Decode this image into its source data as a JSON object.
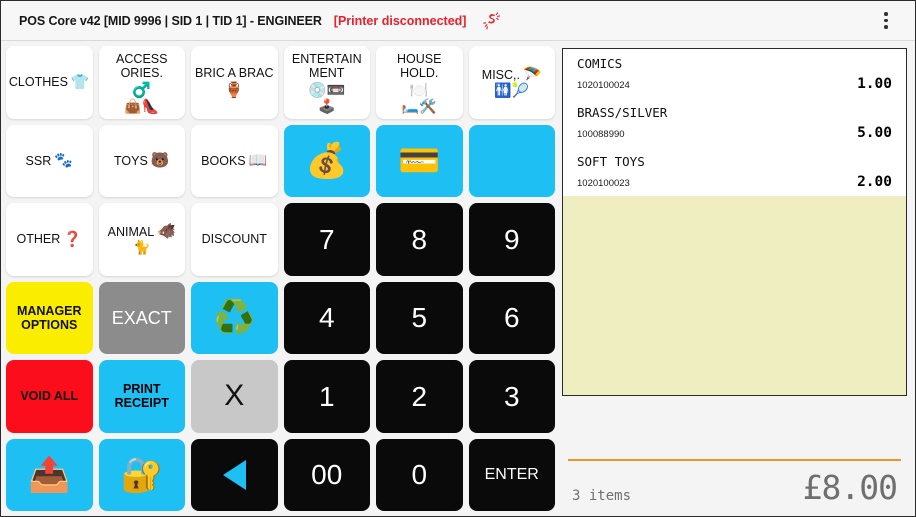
{
  "titlebar": {
    "title": "POS Core v42 [MID 9996 | SID 1 | TID 1] - ENGINEER",
    "status": "[Printer disconnected]",
    "disconnect_icon": "printer-disconnected-icon",
    "menu_icon": "overflow-menu-icon"
  },
  "keypad": {
    "buttons": [
      {
        "id": "clothes",
        "label": "CLOTHES",
        "emoji": "👕",
        "emoji2": "",
        "style": "cat",
        "kind": "category"
      },
      {
        "id": "accessories",
        "label": "ACCESS ORIES.",
        "emoji": "♂️",
        "emoji2": "👜👠",
        "style": "cat",
        "kind": "category"
      },
      {
        "id": "bric-a-brac",
        "label": "BRIC A BRAC",
        "emoji": "🏺",
        "emoji2": "",
        "style": "cat",
        "kind": "category"
      },
      {
        "id": "entertainment",
        "label": "ENTERTAIN MENT",
        "emoji": "💿📼",
        "emoji2": "🕹️",
        "style": "cat",
        "kind": "category"
      },
      {
        "id": "household",
        "label": "HOUSE HOLD.",
        "emoji": "🍽️",
        "emoji2": "🛏️🛠️",
        "style": "cat",
        "kind": "category"
      },
      {
        "id": "misc",
        "label": "MISC,.",
        "emoji": "🪂",
        "emoji2": "🚻🎾",
        "style": "cat",
        "kind": "category"
      },
      {
        "id": "ssr",
        "label": "SSR",
        "emoji": "🐾",
        "emoji2": "",
        "style": "cat",
        "kind": "category"
      },
      {
        "id": "toys",
        "label": "TOYS",
        "emoji": "🐻",
        "emoji2": "",
        "style": "cat",
        "kind": "category"
      },
      {
        "id": "books",
        "label": "BOOKS",
        "emoji": "📖",
        "emoji2": "",
        "style": "cat",
        "kind": "category"
      },
      {
        "id": "cash-payment",
        "label": "",
        "emoji": "💰",
        "emoji2": "",
        "style": "blue",
        "kind": "icon"
      },
      {
        "id": "card-payment",
        "label": "",
        "emoji": "💳",
        "emoji2": "",
        "style": "blue",
        "kind": "icon"
      },
      {
        "id": "blank-blue",
        "label": "",
        "emoji": "",
        "emoji2": "",
        "style": "blue",
        "kind": "blank"
      },
      {
        "id": "other",
        "label": "OTHER",
        "emoji": "❓",
        "emoji2": "",
        "style": "cat",
        "kind": "category"
      },
      {
        "id": "animal",
        "label": "ANIMAL",
        "emoji": "🐗",
        "emoji2": "🐈",
        "style": "cat",
        "kind": "category"
      },
      {
        "id": "discount",
        "label": "DISCOUNT",
        "emoji": "",
        "emoji2": "",
        "style": "cat",
        "kind": "category"
      },
      {
        "id": "key-7",
        "label": "7",
        "emoji": "",
        "emoji2": "",
        "style": "black",
        "kind": "num"
      },
      {
        "id": "key-8",
        "label": "8",
        "emoji": "",
        "emoji2": "",
        "style": "black",
        "kind": "num"
      },
      {
        "id": "key-9",
        "label": "9",
        "emoji": "",
        "emoji2": "",
        "style": "black",
        "kind": "num"
      },
      {
        "id": "manager-options",
        "label": "MANAGER OPTIONS",
        "emoji": "",
        "emoji2": "",
        "style": "yellow",
        "kind": "word"
      },
      {
        "id": "exact",
        "label": "EXACT",
        "emoji": "",
        "emoji2": "",
        "style": "darkgrey",
        "kind": "exact"
      },
      {
        "id": "recycle",
        "label": "",
        "emoji": "♻️",
        "emoji2": "",
        "style": "blue",
        "kind": "icon"
      },
      {
        "id": "key-4",
        "label": "4",
        "emoji": "",
        "emoji2": "",
        "style": "black",
        "kind": "num"
      },
      {
        "id": "key-5",
        "label": "5",
        "emoji": "",
        "emoji2": "",
        "style": "black",
        "kind": "num"
      },
      {
        "id": "key-6",
        "label": "6",
        "emoji": "",
        "emoji2": "",
        "style": "black",
        "kind": "num"
      },
      {
        "id": "void-all",
        "label": "VOID ALL",
        "emoji": "",
        "emoji2": "",
        "style": "red",
        "kind": "word"
      },
      {
        "id": "print-receipt",
        "label": "PRINT RECEIPT",
        "emoji": "",
        "emoji2": "",
        "style": "blue",
        "kind": "word"
      },
      {
        "id": "multiply",
        "label": "X",
        "emoji": "",
        "emoji2": "",
        "style": "grey",
        "kind": "xbtn"
      },
      {
        "id": "key-1",
        "label": "1",
        "emoji": "",
        "emoji2": "",
        "style": "black",
        "kind": "num"
      },
      {
        "id": "key-2",
        "label": "2",
        "emoji": "",
        "emoji2": "",
        "style": "black",
        "kind": "num"
      },
      {
        "id": "key-3",
        "label": "3",
        "emoji": "",
        "emoji2": "",
        "style": "black",
        "kind": "num"
      },
      {
        "id": "cash-out",
        "label": "",
        "emoji": "📤",
        "emoji2": "",
        "style": "blue",
        "kind": "icon"
      },
      {
        "id": "lock-terminal",
        "label": "",
        "emoji": "🔐",
        "emoji2": "",
        "style": "blue",
        "kind": "icon"
      },
      {
        "id": "backspace",
        "label": "",
        "emoji": "",
        "emoji2": "",
        "style": "black",
        "kind": "arrow"
      },
      {
        "id": "key-00",
        "label": "00",
        "emoji": "",
        "emoji2": "",
        "style": "black",
        "kind": "num"
      },
      {
        "id": "key-0",
        "label": "0",
        "emoji": "",
        "emoji2": "",
        "style": "black",
        "kind": "num"
      },
      {
        "id": "key-enter",
        "label": "ENTER",
        "emoji": "",
        "emoji2": "",
        "style": "black",
        "kind": "numsmall"
      }
    ]
  },
  "receipt": {
    "items": [
      {
        "name": "COMICS",
        "code": "1020100024",
        "price": "1.00"
      },
      {
        "name": "BRASS/SILVER",
        "code": "100088990",
        "price": "5.00"
      },
      {
        "name": "SOFT TOYS",
        "code": "1020100023",
        "price": "2.00"
      }
    ]
  },
  "totals": {
    "item_count": "3 items",
    "grand_total": "£8.00"
  },
  "colors": {
    "blue": "#1ec0f3",
    "black": "#0a0a0a",
    "yellow": "#fbed00",
    "red": "#fc0d1b",
    "grey": "#c8c8c8",
    "dark_grey": "#8c8c8c",
    "receipt_bg": "#eeeec0",
    "rule_orange": "#e8962e",
    "status_red": "#e8202a",
    "total_grey": "#6f6f6f"
  }
}
